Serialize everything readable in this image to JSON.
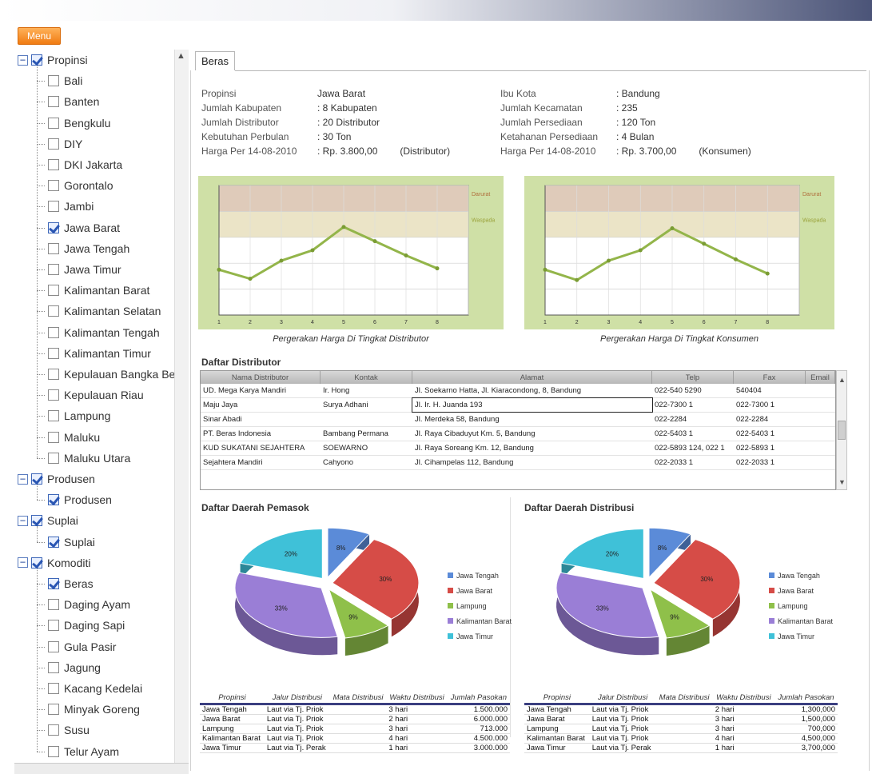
{
  "menu": {
    "label": "Menu"
  },
  "tree": {
    "items": [
      {
        "label": "Propinsi",
        "level": 0,
        "checked": true,
        "expander": "−"
      },
      {
        "label": "Bali",
        "level": 1,
        "checked": false
      },
      {
        "label": "Banten",
        "level": 1,
        "checked": false
      },
      {
        "label": "Bengkulu",
        "level": 1,
        "checked": false
      },
      {
        "label": "DIY",
        "level": 1,
        "checked": false
      },
      {
        "label": "DKI Jakarta",
        "level": 1,
        "checked": false
      },
      {
        "label": "Gorontalo",
        "level": 1,
        "checked": false
      },
      {
        "label": "Jambi",
        "level": 1,
        "checked": false
      },
      {
        "label": "Jawa Barat",
        "level": 1,
        "checked": true
      },
      {
        "label": "Jawa Tengah",
        "level": 1,
        "checked": false
      },
      {
        "label": "Jawa Timur",
        "level": 1,
        "checked": false
      },
      {
        "label": "Kalimantan Barat",
        "level": 1,
        "checked": false
      },
      {
        "label": "Kalimantan Selatan",
        "level": 1,
        "checked": false
      },
      {
        "label": "Kalimantan Tengah",
        "level": 1,
        "checked": false
      },
      {
        "label": "Kalimantan Timur",
        "level": 1,
        "checked": false
      },
      {
        "label": "Kepulauan Bangka Beli",
        "level": 1,
        "checked": false
      },
      {
        "label": "Kepulauan Riau",
        "level": 1,
        "checked": false
      },
      {
        "label": "Lampung",
        "level": 1,
        "checked": false
      },
      {
        "label": "Maluku",
        "level": 1,
        "checked": false
      },
      {
        "label": "Maluku Utara",
        "level": 1,
        "checked": false
      },
      {
        "label": "Produsen",
        "level": 0,
        "checked": true,
        "expander": "−"
      },
      {
        "label": "Produsen",
        "level": 1,
        "checked": true
      },
      {
        "label": "Suplai",
        "level": 0,
        "checked": true,
        "expander": "−"
      },
      {
        "label": "Suplai",
        "level": 1,
        "checked": true
      },
      {
        "label": "Komoditi",
        "level": 0,
        "checked": true,
        "expander": "−"
      },
      {
        "label": "Beras",
        "level": 1,
        "checked": true
      },
      {
        "label": "Daging Ayam",
        "level": 1,
        "checked": false
      },
      {
        "label": "Daging Sapi",
        "level": 1,
        "checked": false
      },
      {
        "label": "Gula Pasir",
        "level": 1,
        "checked": false
      },
      {
        "label": "Jagung",
        "level": 1,
        "checked": false
      },
      {
        "label": "Kacang Kedelai",
        "level": 1,
        "checked": false
      },
      {
        "label": "Minyak Goreng",
        "level": 1,
        "checked": false
      },
      {
        "label": "Susu",
        "level": 1,
        "checked": false
      },
      {
        "label": "Telur Ayam",
        "level": 1,
        "checked": false
      }
    ]
  },
  "tab": {
    "label": "Beras"
  },
  "info_left": [
    {
      "key": "Propinsi",
      "value": "Jawa Barat"
    },
    {
      "key": "Jumlah Kabupaten",
      "value": ": 8 Kabupaten"
    },
    {
      "key": "Jumlah Distributor",
      "value": ": 20 Distributor"
    },
    {
      "key": "Kebutuhan Perbulan",
      "value": ": 30 Ton"
    },
    {
      "key": "Harga Per 14-08-2010",
      "value": ": Rp. 3.800,00",
      "extra": "(Distributor)"
    }
  ],
  "info_right": [
    {
      "key": "Ibu Kota",
      "value": ": Bandung"
    },
    {
      "key": "Jumlah Kecamatan",
      "value": ": 235"
    },
    {
      "key": "Jumlah Persediaan",
      "value": ": 120 Ton"
    },
    {
      "key": "Ketahanan Persediaan",
      "value": ": 4 Bulan"
    },
    {
      "key": "Harga Per 14-08-2010",
      "value": ": Rp. 3.700,00",
      "extra": "(Konsumen)"
    }
  ],
  "chart_data": [
    {
      "type": "line",
      "title": "Pergerakan Harga Di Tingkat Distributor",
      "x": [
        1,
        2,
        3,
        4,
        5,
        6,
        7,
        8
      ],
      "series": [
        {
          "values": [
            35,
            28,
            42,
            50,
            68,
            57,
            46,
            36
          ]
        }
      ],
      "ylim": [
        0,
        100
      ],
      "band_labels": [
        "Darurat",
        "Waspada"
      ],
      "colors": {
        "line": "#93b54a",
        "bg": "#cfe0a6",
        "band_top": "#d9c2ae",
        "band_mid": "#e8dfbd"
      }
    },
    {
      "type": "line",
      "title": "Pergerakan Harga Di Tingkat Konsumen",
      "x": [
        1,
        2,
        3,
        4,
        5,
        6,
        7,
        8
      ],
      "series": [
        {
          "values": [
            35,
            27,
            42,
            50,
            67,
            55,
            43,
            32
          ]
        }
      ],
      "ylim": [
        0,
        100
      ],
      "band_labels": [
        "Darurat",
        "Waspada"
      ],
      "colors": {
        "line": "#93b54a",
        "bg": "#cfe0a6",
        "band_top": "#d9c2ae",
        "band_mid": "#e8dfbd"
      }
    },
    {
      "type": "pie",
      "title": "Daftar Daerah Pemasok",
      "labels": [
        "Jawa Tengah",
        "Jawa Barat",
        "Lampung",
        "Kalimantan Barat",
        "Jawa Timur"
      ],
      "values": [
        8,
        30,
        9,
        33,
        20
      ],
      "colors": [
        "#5b8bd8",
        "#d64c47",
        "#8fc04a",
        "#9a7ed6",
        "#3fc1d8"
      ]
    },
    {
      "type": "pie",
      "title": "Daftar Daerah Distribusi",
      "labels": [
        "Jawa Tengah",
        "Jawa Barat",
        "Lampung",
        "Kalimantan Barat",
        "Jawa Timur"
      ],
      "values": [
        8,
        30,
        9,
        33,
        20
      ],
      "colors": [
        "#5b8bd8",
        "#d64c47",
        "#8fc04a",
        "#9a7ed6",
        "#3fc1d8"
      ]
    }
  ],
  "distributor": {
    "title": "Daftar Distributor",
    "headers": [
      "Nama Distributor",
      "Kontak",
      "Alamat",
      "Telp",
      "Fax",
      "Email"
    ],
    "rows": [
      [
        "UD. Mega Karya Mandiri",
        "Ir. Hong",
        "Jl. Soekarno Hatta, Jl. Kiaracondong, 8, Bandung",
        "022-540 5290",
        "540404",
        ""
      ],
      [
        "Maju Jaya",
        "Surya Adhani",
        "Jl. Ir. H. Juanda 193",
        "022-7300 1",
        "022-7300 1",
        ""
      ],
      [
        "Sinar Abadi",
        "",
        "Jl. Merdeka 58, Bandung",
        "022-2284",
        "022-2284",
        ""
      ],
      [
        "PT. Beras Indonesia",
        "Bambang Permana",
        "Jl. Raya Cibaduyut Km. 5, Bandung",
        "022-5403 1",
        "022-5403 1",
        ""
      ],
      [
        "KUD SUKATANI SEJAHTERA",
        "SOEWARNO",
        "Jl. Raya Soreang Km. 12, Bandung",
        "022-5893 124, 022 1",
        "022-5893 1",
        ""
      ],
      [
        "Sejahtera Mandiri",
        "Cahyono",
        "Jl. Cihampelas 112, Bandung",
        "022-2033 1",
        "022-2033 1",
        ""
      ]
    ]
  },
  "table_left": {
    "headers": [
      "Propinsi",
      "Jalur Distribusi",
      "Mata Distribusi",
      "Waktu Distribusi",
      "Jumlah Pasokan"
    ],
    "rows": [
      [
        "Jawa Tengah",
        "Laut via Tj. Priok",
        "",
        "3 hari",
        "1.500.000"
      ],
      [
        "Jawa Barat",
        "Laut via Tj. Priok",
        "",
        "2 hari",
        "6.000.000"
      ],
      [
        "Lampung",
        "Laut via Tj. Priok",
        "",
        "3 hari",
        "713.000"
      ],
      [
        "Kalimantan Barat",
        "Laut via Tj. Priok",
        "",
        "4 hari",
        "4.500.000"
      ],
      [
        "Jawa Timur",
        "Laut via Tj. Perak",
        "",
        "1 hari",
        "3.000.000"
      ]
    ]
  },
  "table_right": {
    "headers": [
      "Propinsi",
      "Jalur Distribusi",
      "Mata Distribusi",
      "Waktu Distribusi",
      "Jumlah Pasokan"
    ],
    "rows": [
      [
        "Jawa Tengah",
        "Laut via Tj. Priok",
        "",
        "2 hari",
        "1,300,000"
      ],
      [
        "Jawa Barat",
        "Laut via Tj. Priok",
        "",
        "3 hari",
        "1,500,000"
      ],
      [
        "Lampung",
        "Laut via Tj. Priok",
        "",
        "3 hari",
        "700,000"
      ],
      [
        "Kalimantan Barat",
        "Laut via Tj. Priok",
        "",
        "4 hari",
        "4,500,000"
      ],
      [
        "Jawa Timur",
        "Laut via Tj. Perak",
        "",
        "1 hari",
        "3,700,000"
      ]
    ]
  }
}
